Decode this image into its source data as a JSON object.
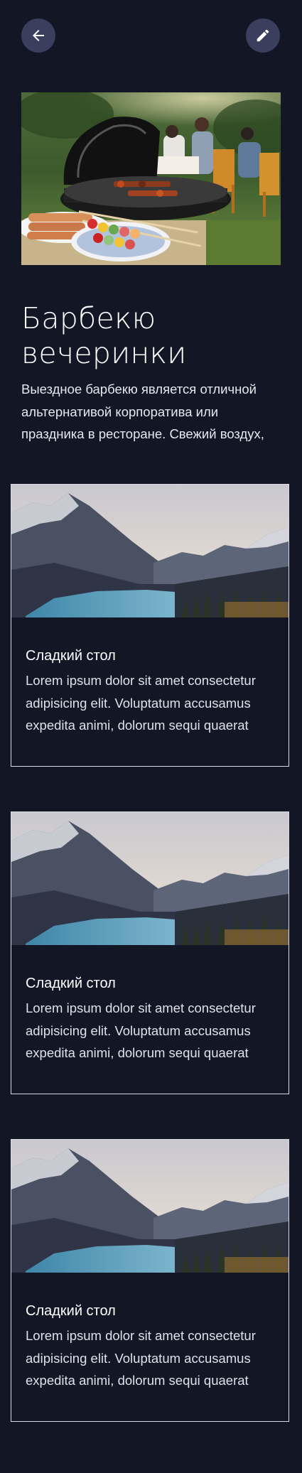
{
  "header": {
    "back_icon": "arrow-left-icon",
    "edit_icon": "pencil-icon"
  },
  "hero": {
    "image": "barbecue-grill-party-photo"
  },
  "event": {
    "title": "Барбекю вечеринки",
    "description": "Выездное барбекю является отличной альтернативой корпоратива или праздника в ресторане. Свежий воздух,"
  },
  "cards": [
    {
      "image": "mountain-lake-photo",
      "title": "Сладкий стол",
      "text": "Lorem ipsum dolor sit amet consectetur adipisicing elit. Voluptatum accusamus expedita animi, dolorum sequi quaerat"
    },
    {
      "image": "mountain-lake-photo",
      "title": "Сладкий стол",
      "text": "Lorem ipsum dolor sit amet consectetur adipisicing elit. Voluptatum accusamus expedita animi, dolorum sequi quaerat"
    },
    {
      "image": "mountain-lake-photo",
      "title": "Сладкий стол",
      "text": "Lorem ipsum dolor sit amet consectetur adipisicing elit. Voluptatum accusamus expedita animi, dolorum sequi quaerat"
    }
  ],
  "colors": {
    "background": "#131625",
    "button_bg": "#3a3f5e",
    "card_border": "#d9dbe4"
  }
}
